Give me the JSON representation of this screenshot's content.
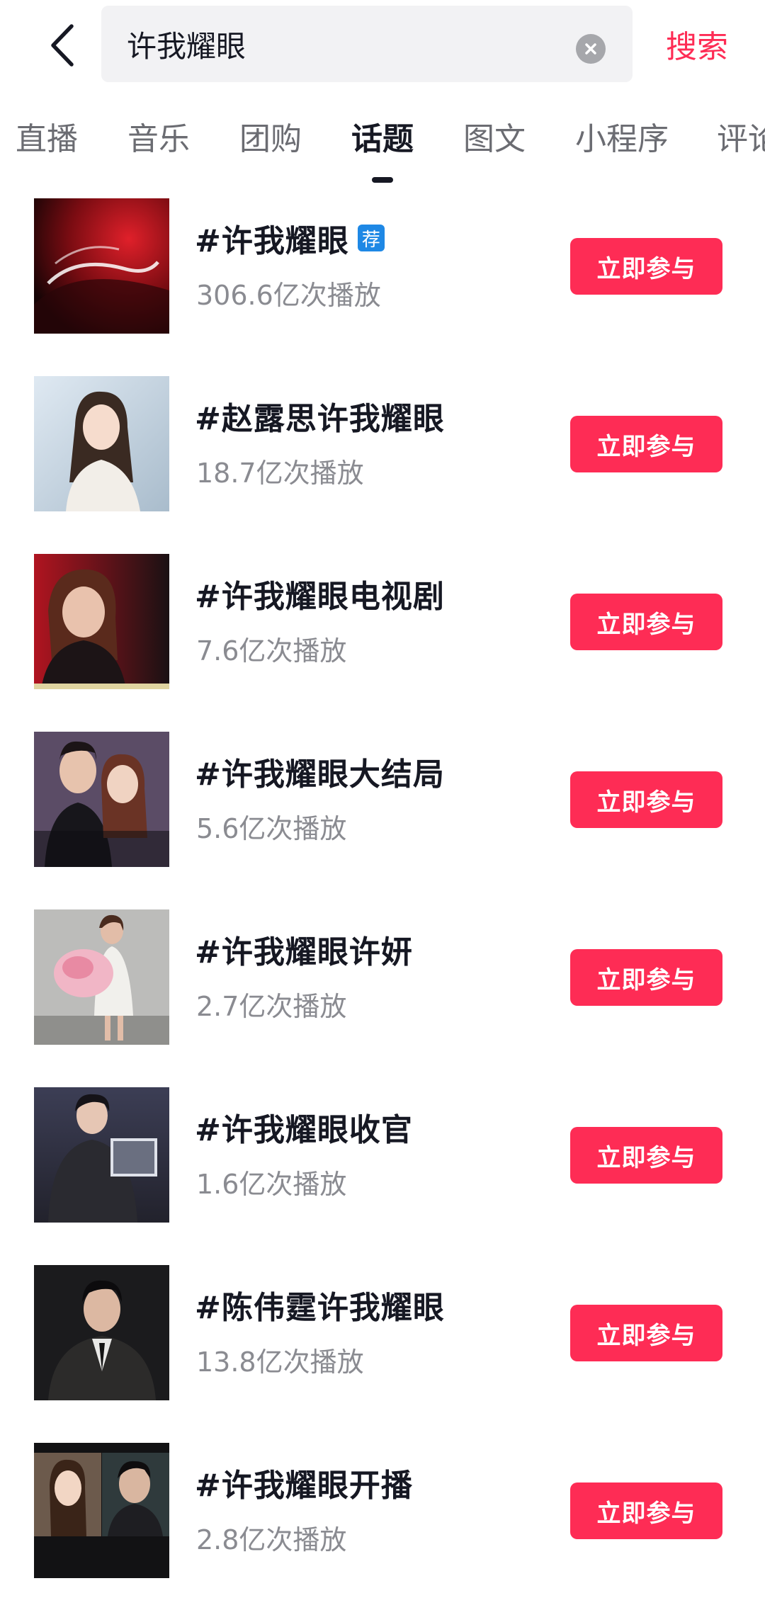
{
  "header": {
    "back_icon": "chevron-left-icon",
    "query": "许我耀眼",
    "clear_icon": "clear-circle-icon",
    "search_label": "搜索"
  },
  "tabs": [
    {
      "label": "直播"
    },
    {
      "label": "音乐"
    },
    {
      "label": "团购"
    },
    {
      "label": "话题",
      "active": true
    },
    {
      "label": "图文"
    },
    {
      "label": "小程序"
    },
    {
      "label": "评论"
    }
  ],
  "colors": {
    "accent": "#fe2c55",
    "badge": "#1e88e5",
    "text_primary": "#161823",
    "text_secondary": "#8a8b91"
  },
  "topics": [
    {
      "title": "#许我耀眼",
      "badge": "荐",
      "plays": "306.6亿次播放",
      "button": "立即参与"
    },
    {
      "title": "#赵露思许我耀眼",
      "badge": "",
      "plays": "18.7亿次播放",
      "button": "立即参与"
    },
    {
      "title": "#许我耀眼电视剧",
      "badge": "",
      "plays": "7.6亿次播放",
      "button": "立即参与"
    },
    {
      "title": "#许我耀眼大结局",
      "badge": "",
      "plays": "5.6亿次播放",
      "button": "立即参与"
    },
    {
      "title": "#许我耀眼许妍",
      "badge": "",
      "plays": "2.7亿次播放",
      "button": "立即参与"
    },
    {
      "title": "#许我耀眼收官",
      "badge": "",
      "plays": "1.6亿次播放",
      "button": "立即参与"
    },
    {
      "title": "#陈伟霆许我耀眼",
      "badge": "",
      "plays": "13.8亿次播放",
      "button": "立即参与"
    },
    {
      "title": "#许我耀眼开播",
      "badge": "",
      "plays": "2.8亿次播放",
      "button": "立即参与"
    }
  ]
}
